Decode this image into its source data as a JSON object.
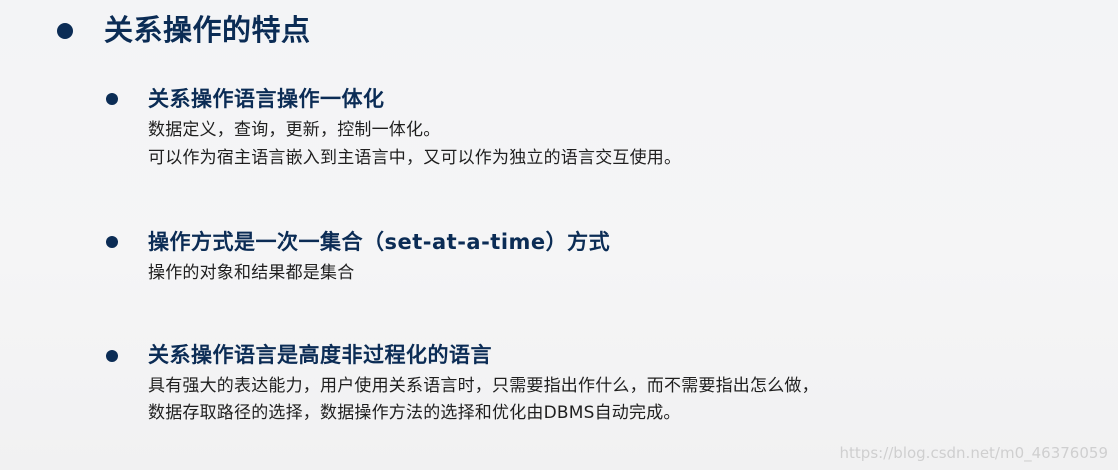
{
  "title": "关系操作的特点",
  "sections": [
    {
      "heading": "关系操作语言操作一体化",
      "lines": [
        "数据定义，查询，更新，控制一体化。",
        "可以作为宿主语言嵌入到主语言中，又可以作为独立的语言交互使用。"
      ]
    },
    {
      "heading": "操作方式是一次一集合（set-at-a-time）方式",
      "lines": [
        "操作的对象和结果都是集合"
      ]
    },
    {
      "heading": "关系操作语言是高度非过程化的语言",
      "lines": [
        "具有强大的表达能力，用户使用关系语言时，只需要指出作什么，而不需要指出怎么做，",
        "数据存取路径的选择，数据操作方法的选择和优化由DBMS自动完成。"
      ]
    }
  ],
  "watermark": "https://blog.csdn.net/m0_46376059"
}
